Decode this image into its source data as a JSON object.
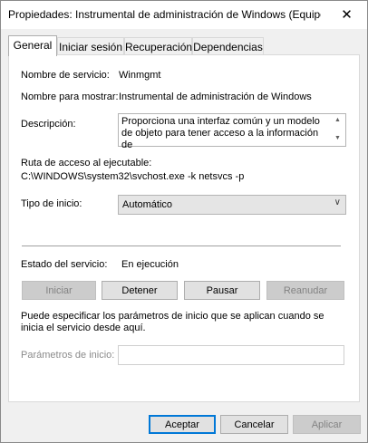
{
  "window": {
    "title": "Propiedades: Instrumental de administración de Windows (Equipo l...",
    "close_icon": "close-icon"
  },
  "tabs": [
    {
      "label": "General",
      "active": true
    },
    {
      "label": "Iniciar sesión",
      "active": false
    },
    {
      "label": "Recuperación",
      "active": false
    },
    {
      "label": "Dependencias",
      "active": false
    }
  ],
  "general": {
    "service_name_label": "Nombre de servicio:",
    "service_name_value": "Winmgmt",
    "display_name_label": "Nombre para mostrar:",
    "display_name_value": "Instrumental de administración de Windows",
    "description_label": "Descripción:",
    "description_value": "Proporciona una interfaz común y un modelo de objeto para tener acceso a la información de",
    "path_label": "Ruta de acceso al ejecutable:",
    "path_value": "C:\\WINDOWS\\system32\\svchost.exe -k netsvcs -p",
    "startup_type_label": "Tipo de inicio:",
    "startup_type_value": "Automático",
    "service_status_label": "Estado del servicio:",
    "service_status_value": "En ejecución",
    "buttons": {
      "start": "Iniciar",
      "stop": "Detener",
      "pause": "Pausar",
      "resume": "Reanudar"
    },
    "params_hint": "Puede especificar los parámetros de inicio que se aplican cuando se inicia el servicio desde aquí.",
    "params_label": "Parámetros de inicio:",
    "params_value": ""
  },
  "footer": {
    "accept": "Aceptar",
    "cancel": "Cancelar",
    "apply": "Aplicar"
  },
  "colors": {
    "accent": "#0078d7",
    "disabled_text": "#838383"
  }
}
